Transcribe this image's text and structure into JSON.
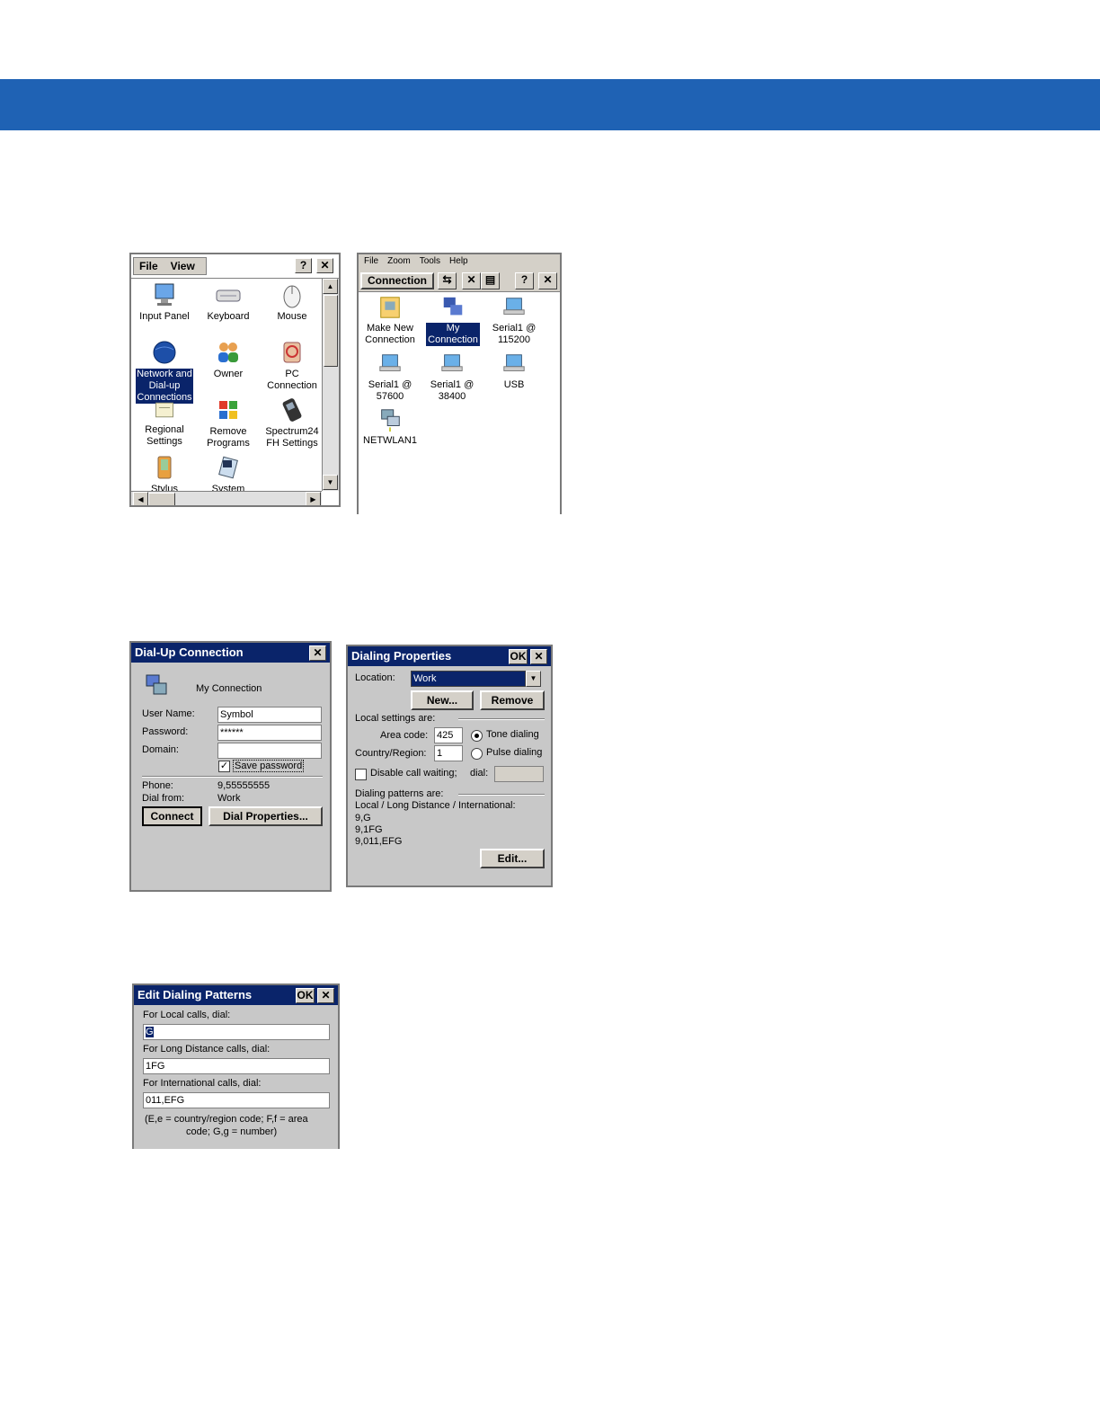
{
  "colors": {
    "header_band": "#1f62b4",
    "titlebar": "#0a246a",
    "dialog_bg": "#c8c8c8"
  },
  "control_panel": {
    "menu": [
      "File",
      "View"
    ],
    "help_btn": "?",
    "close_btn": "✕",
    "items": [
      {
        "label": "Input Panel",
        "icon": "monitor-icon"
      },
      {
        "label": "Keyboard",
        "icon": "keyboard-icon"
      },
      {
        "label": "Mouse",
        "icon": "mouse-icon"
      },
      {
        "label": "Network and Dial-up Connections",
        "icon": "globe-icon",
        "selected": true
      },
      {
        "label": "Owner",
        "icon": "people-icon"
      },
      {
        "label": "PC Connection",
        "icon": "pc-connection-icon"
      },
      {
        "label": "Regional Settings",
        "icon": "regional-icon"
      },
      {
        "label": "Remove Programs",
        "icon": "remove-programs-icon"
      },
      {
        "label": "Spectrum24 FH Settings",
        "icon": "spectrum-icon"
      },
      {
        "label": "Stylus",
        "icon": "stylus-icon"
      },
      {
        "label": "System",
        "icon": "system-icon"
      }
    ],
    "label_net": [
      "Network and",
      "Dial-up",
      "Connections"
    ],
    "label_pc": [
      "PC",
      "Connection"
    ],
    "label_regional": [
      "Regional",
      "Settings"
    ],
    "label_remove": [
      "Remove",
      "Programs"
    ],
    "label_spectrum": [
      "Spectrum24",
      "FH Settings"
    ]
  },
  "connections": {
    "menu": [
      "File",
      "Zoom",
      "Tools",
      "Help"
    ],
    "toolbar_label": "Connection",
    "help_btn": "?",
    "close_btn": "✕",
    "items": [
      {
        "line1": "Make New",
        "line2": "Connection"
      },
      {
        "line1": "My",
        "line2": "Connection"
      },
      {
        "line1": "Serial1 @",
        "line2": "115200"
      },
      {
        "line1": "Serial1 @",
        "line2": "57600"
      },
      {
        "line1": "Serial1 @",
        "line2": "38400"
      },
      {
        "line1": "USB",
        "line2": ""
      },
      {
        "line1": "NETWLAN1",
        "line2": ""
      }
    ]
  },
  "dialup": {
    "title": "Dial-Up Connection",
    "close_btn": "✕",
    "connection_name": "My Connection",
    "user_label": "User Name:",
    "user_value": "Symbol",
    "password_label": "Password:",
    "password_value": "******",
    "domain_label": "Domain:",
    "domain_value": "",
    "save_password": "Save password",
    "phone_label": "Phone:",
    "phone_value": "9,55555555",
    "dialfrom_label": "Dial from:",
    "dialfrom_value": "Work",
    "connect_btn": "Connect",
    "dial_props_btn": "Dial Properties..."
  },
  "dialing": {
    "title": "Dialing Properties",
    "ok_btn": "OK",
    "close_btn": "✕",
    "location_label": "Location:",
    "location_value": "Work",
    "new_btn": "New...",
    "remove_btn": "Remove",
    "local_settings": "Local settings are:",
    "area_label": "Area code:",
    "area_value": "425",
    "country_label": "Country/Region:",
    "country_value": "1",
    "tone": "Tone dialing",
    "pulse": "Pulse dialing",
    "disable_wait": "Disable call waiting;",
    "dial_label": "dial:",
    "patterns_label": "Dialing patterns are:",
    "patterns_desc": "Local / Long Distance / International:",
    "pattern_local": "9,G",
    "pattern_long": "9,1FG",
    "pattern_intl": "9,011,EFG",
    "edit_btn": "Edit..."
  },
  "edit_patterns": {
    "title": "Edit Dialing Patterns",
    "ok_btn": "OK",
    "close_btn": "✕",
    "local_label": "For Local calls, dial:",
    "local_value": "G",
    "long_label": "For Long Distance calls, dial:",
    "long_value": "1FG",
    "intl_label": "For International calls, dial:",
    "intl_value": "011,EFG",
    "note1": "(E,e = country/region code; F,f = area",
    "note2": "code; G,g = number)"
  }
}
